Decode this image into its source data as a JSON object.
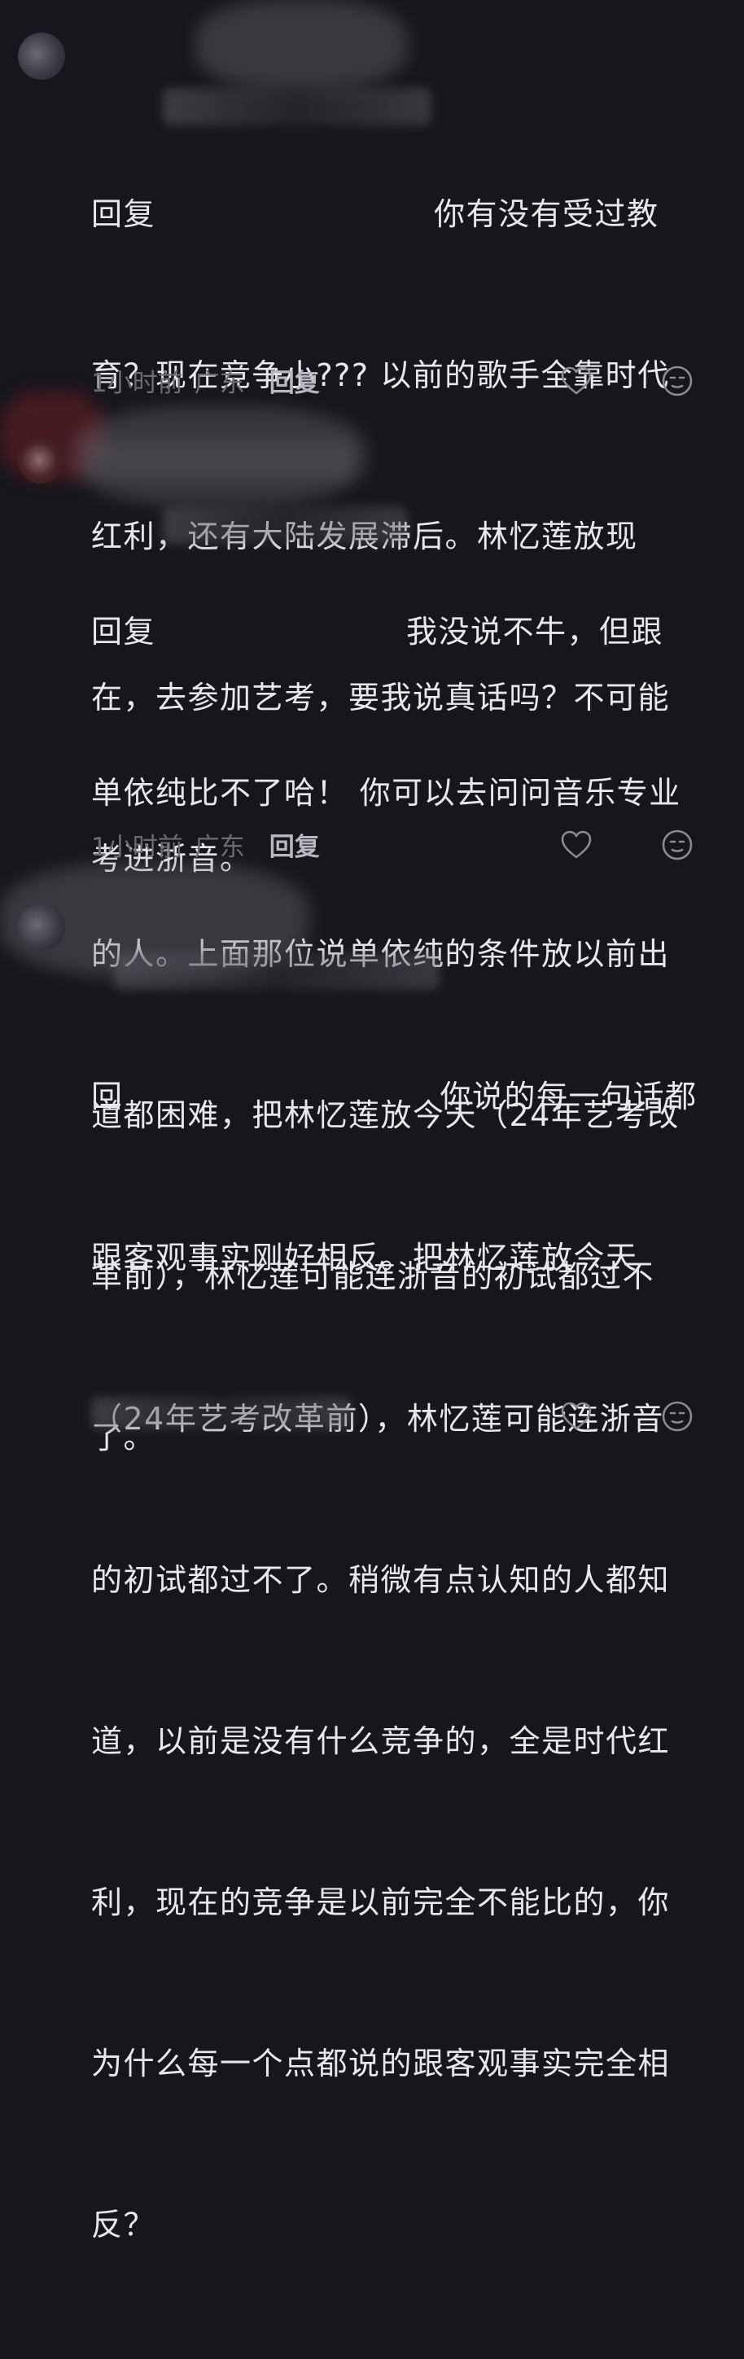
{
  "comments": [
    {
      "reply_prefix": "回复",
      "text": "你有没有受过教育？现在竞争小??? 以前的歌手全靠时代红利，还有大陆发展滞后。林忆莲放现在，去参加艺考，要我说真话吗？不可能考进浙音。",
      "lines": [
        "你有没有受过教",
        "育？现在竞争小??? 以前的歌手全靠时代",
        "红利，还有大陆发展滞后。林忆莲放现",
        "在，去参加艺考，要我说真话吗？不可能",
        "考进浙音。"
      ],
      "time": "1小时前",
      "location": "广东",
      "reply_label": "回复"
    },
    {
      "reply_prefix": "回复",
      "text": "我没说不牛，但跟单依纯比不了哈！ 你可以去问问音乐专业的人。上面那位说单依纯的条件放以前出道都困难，把林忆莲放今天（24年艺考改革前），林忆莲可能连浙音的初试都过不了。",
      "lines": [
        "我没说不牛，但跟",
        "单依纯比不了哈！ 你可以去问问音乐专业",
        "的人。上面那位说单依纯的条件放以前出",
        "道都困难，把林忆莲放今天（24年艺考改",
        "革前），林忆莲可能连浙音的初试都过不",
        "了。"
      ],
      "time": "1小时前",
      "location": "广东",
      "reply_label": "回复"
    },
    {
      "reply_prefix": "回",
      "text": "你说的每一句话都跟客观事实刚好相反。把林忆莲放今天（24年艺考改革前），林忆莲可能连浙音的初试都过不了。稍微有点认知的人都知道，以前是没有什么竞争的，全是时代红利，现在的竞争是以前完全不能比的，你为什么每一个点都说的跟客观事实完全相反？",
      "lines": [
        "你说的每一句话都",
        "跟客观事实刚好相反。把林忆莲放今天",
        "（24年艺考改革前），林忆莲可能连浙音",
        "的初试都过不了。稍微有点认知的人都知",
        "道，以前是没有什么竞争的，全是时代红",
        "利，现在的竞争是以前完全不能比的，你",
        "为什么每一个点都说的跟客观事实完全相",
        "反？"
      ]
    }
  ],
  "icons": {
    "like": "heart-outline-icon",
    "emoji": "neutral-face-icon"
  },
  "colors": {
    "background": "#16161c",
    "text": "#e8e8ec",
    "meta": "#6c6c74",
    "reply": "#b8b8c0"
  }
}
